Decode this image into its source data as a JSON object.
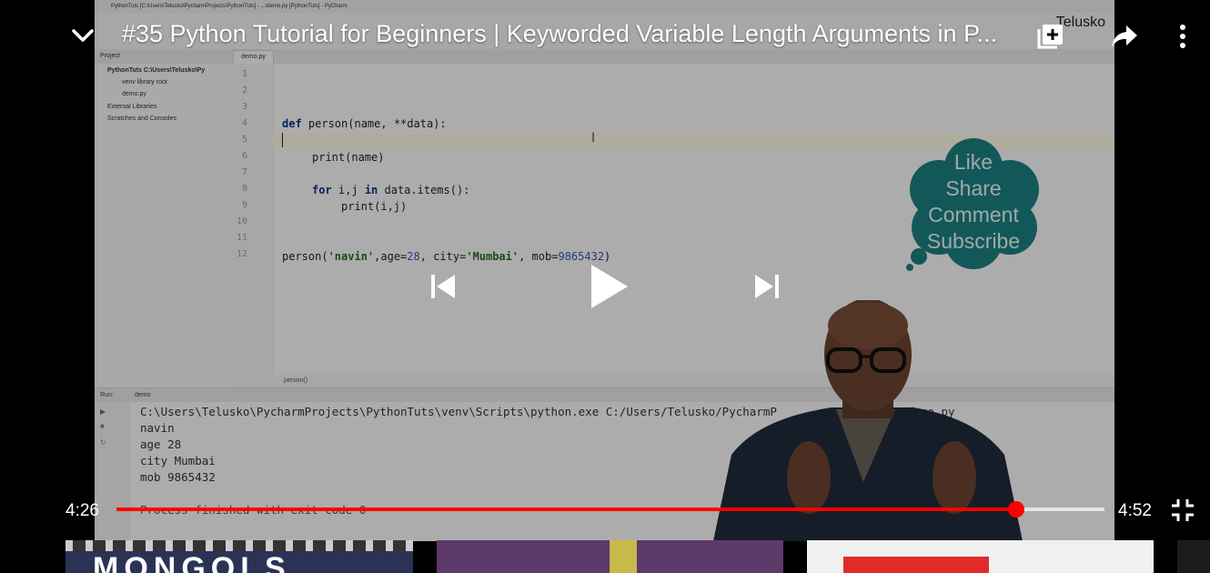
{
  "player": {
    "title": "#35 Python Tutorial for Beginners | Keyworded Variable Length Arguments in P...",
    "current_time": "4:26",
    "duration": "4:52",
    "progress_fraction": 0.9107,
    "accent_color": "#ff0000"
  },
  "icons": {
    "collapse": "chevron-down-icon",
    "add_to_playlist": "playlist-add-icon",
    "share": "share-icon",
    "more": "more-vert-icon",
    "previous": "skip-previous-icon",
    "play": "play-icon",
    "next": "skip-next-icon",
    "exit_fullscreen": "fullscreen-exit-icon"
  },
  "video": {
    "ide_title": "PythonTuts [C:\\Users\\Telusko\\PycharmProjects\\PythonTuts] - ...\\demo.py [PythonTuts] - PyCharm",
    "channel_logo": "Telusko",
    "project_label": "Project",
    "file_tab": "demo.py",
    "project_tree": [
      "PythonTuts C:\\Users\\Telusko\\Py",
      "venv library root",
      "demo.py",
      "External Libraries",
      "Scratches and Consoles"
    ],
    "line_numbers": [
      "1",
      "2",
      "3",
      "4",
      "5",
      "6",
      "7",
      "8",
      "9",
      "10",
      "11",
      "12"
    ],
    "code": {
      "def_kw": "def",
      "def_rest": " person(name, **data):",
      "print_name": "print(name)",
      "for_kw": "for",
      "for_mid": " i,j ",
      "in_kw": "in",
      "for_rest": " data.items():",
      "print_ij": "print(i,j)",
      "call_start": "person(",
      "call_s1": "'navin'",
      "call_age_key": ",age=",
      "call_age": "28",
      "call_city_key": ", city=",
      "call_s2": "'Mumbai'",
      "call_mob_key": ", mob=",
      "call_mob": "9865432",
      "call_end": ")"
    },
    "breadcrumb": "person()",
    "run_label": "Run:",
    "run_tab": "demo",
    "console": [
      "C:\\Users\\Telusko\\PycharmProjects\\PythonTuts\\venv\\Scripts\\python.exe C:/Users/Telusko/PycharmP         ythonTuts/demo.py",
      "navin",
      "age 28",
      "city Mumbai",
      "mob 9865432",
      "",
      "Process finished with exit code 0"
    ],
    "cloud_lines": [
      "Like",
      "Share",
      "Comment",
      "Subscribe"
    ]
  },
  "suggestions": {
    "first_thumb_text": "MONGOLS"
  }
}
